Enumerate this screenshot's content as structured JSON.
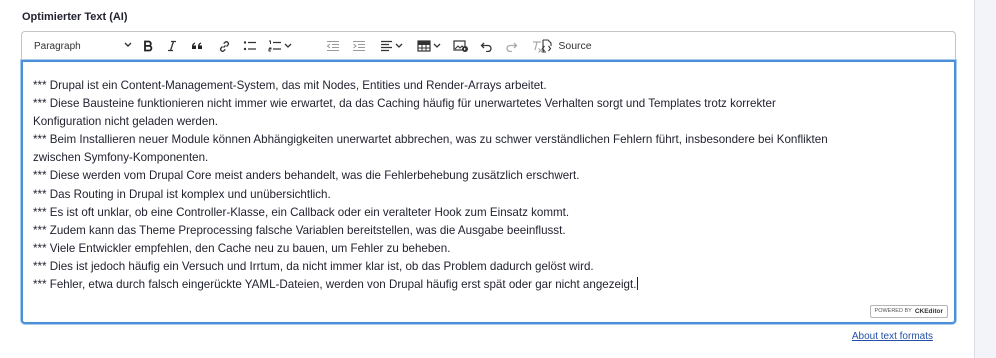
{
  "field": {
    "label": "Optimierter Text (AI)"
  },
  "toolbar": {
    "paragraph_format": "Paragraph",
    "source_label": "Source",
    "icons": [
      "bold-icon",
      "italic-icon",
      "blockquote-icon",
      "link-icon",
      "bulleted-list-icon",
      "numbered-list-icon",
      "outdent-icon",
      "indent-icon",
      "align-icon",
      "table-icon",
      "media-icon",
      "undo-icon",
      "redo-icon",
      "remove-format-icon",
      "source-icon"
    ]
  },
  "content": {
    "lines": [
      "*** Drupal ist ein Content-Management-System, das mit Nodes, Entities und Render-Arrays arbeitet.",
      "*** Diese Bausteine funktionieren nicht immer wie erwartet, da das Caching häufig für unerwartetes Verhalten sorgt und Templates trotz korrekter",
      "Konfiguration nicht geladen werden.",
      "*** Beim Installieren neuer Module können Abhängigkeiten unerwartet abbrechen, was zu schwer verständlichen Fehlern führt, insbesondere bei Konflikten",
      "zwischen Symfony-Komponenten.",
      "*** Diese werden vom Drupal Core meist anders behandelt, was die Fehlerbehebung zusätzlich erschwert.",
      "*** Das Routing in Drupal ist komplex und unübersichtlich.",
      "*** Es ist oft unklar, ob eine Controller-Klasse, ein Callback oder ein veralteter Hook zum Einsatz kommt.",
      "*** Zudem kann das Theme Preprocessing falsche Variablen bereitstellen, was die Ausgabe beeinflusst.",
      "*** Viele Entwickler empfehlen, den Cache neu zu bauen, um Fehler zu beheben.",
      "*** Dies ist jedoch häufig ein Versuch und Irrtum, da nicht immer klar ist, ob das Problem dadurch gelöst wird.",
      "*** Fehler, etwa durch falsch eingerückte YAML-Dateien, werden von Drupal häufig erst spät oder gar nicht angezeigt."
    ]
  },
  "badge": {
    "powered": "POWERED BY",
    "brand": "CKEditor"
  },
  "footer": {
    "about_link": "About text formats"
  }
}
